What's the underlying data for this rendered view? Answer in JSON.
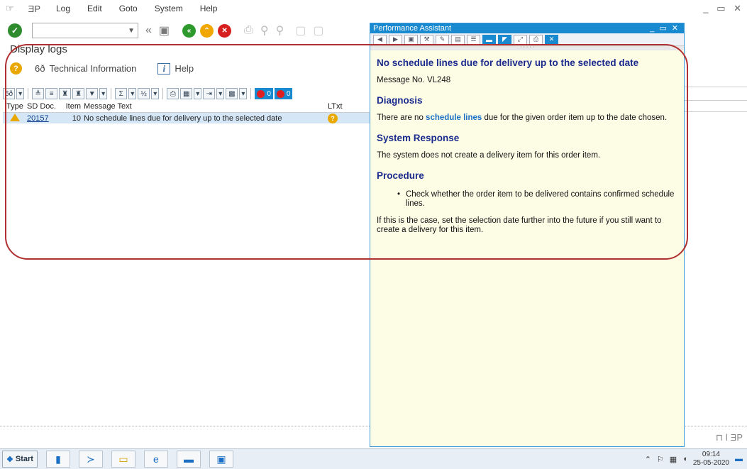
{
  "menu": {
    "items": [
      "Log",
      "Edit",
      "Goto",
      "System",
      "Help"
    ]
  },
  "title": "Display logs",
  "app_toolbar": {
    "technical_information": "Technical Information",
    "help": "Help"
  },
  "alv_counts": {
    "stop": "0",
    "error": "0"
  },
  "table": {
    "headers": [
      "Type",
      "SD Doc.",
      "Item",
      "Message Text",
      "LTxt"
    ],
    "rows": [
      {
        "doc": "20157",
        "item": "10",
        "message": "No schedule lines due for delivery up to the selected date"
      }
    ]
  },
  "assistant": {
    "title": "Performance Assistant",
    "heading": "No schedule lines due for delivery up to the selected date",
    "message_no": "Message No. VL248",
    "diagnosis_h": "Diagnosis",
    "diagnosis_pre": "There are no ",
    "diagnosis_link": "schedule lines",
    "diagnosis_post": " due for the given order item up to the date chosen.",
    "response_h": "System Response",
    "response": "The system does not create a delivery item for this order item.",
    "procedure_h": "Procedure",
    "procedure_item": "Check whether the order item to be delivered contains confirmed schedule lines.",
    "procedure_note": "If this is the case, set the selection date further into the future if you still want to create a delivery for this item."
  },
  "taskbar": {
    "start": "Start",
    "time": "09:14",
    "date": "25-05-2020"
  },
  "colors": {
    "accent": "#1a8ad0",
    "heading": "#1a2a8c",
    "warning": "#e9a800",
    "annotation": "#b03030"
  }
}
